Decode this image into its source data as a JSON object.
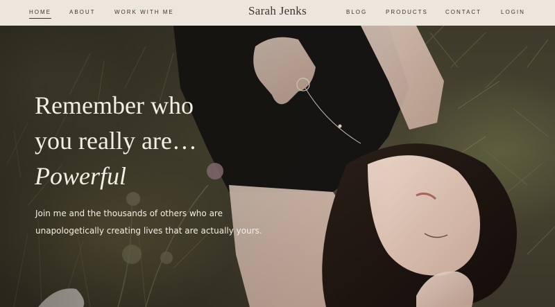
{
  "nav": {
    "left": [
      "HOME",
      "ABOUT",
      "WORK WITH ME"
    ],
    "brand": "Sarah Jenks",
    "right": [
      "BLOG",
      "PRODUCTS",
      "CONTACT",
      "LOGIN"
    ],
    "active": "HOME"
  },
  "hero": {
    "headline_line1": "Remember who",
    "headline_line2": "you really are…",
    "headline_accent": "Powerful",
    "subtext_line1": "Join me and the thousands of others who are",
    "subtext_line2": "unapologetically creating lives that are actually yours."
  },
  "colors": {
    "nav_bg": "#ece6dc",
    "nav_text": "#3a3630",
    "hero_text": "#f4efe6"
  }
}
